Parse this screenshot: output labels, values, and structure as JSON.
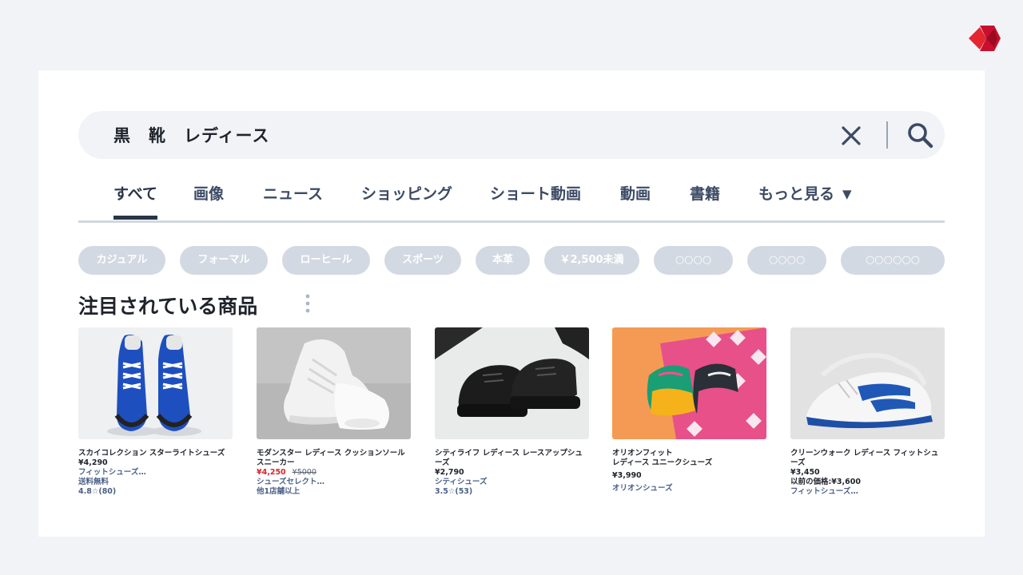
{
  "search": {
    "query": "黒　靴　レディース"
  },
  "tabs": [
    {
      "label": "すべて"
    },
    {
      "label": "画像"
    },
    {
      "label": "ニュース"
    },
    {
      "label": "ショッピング"
    },
    {
      "label": "ショート動画"
    },
    {
      "label": "動画"
    },
    {
      "label": "書籍"
    },
    {
      "label": "もっと見る",
      "caret": "▼"
    }
  ],
  "active_tab": "すべて",
  "chips": [
    {
      "label": "カジュアル"
    },
    {
      "label": "フォーマル"
    },
    {
      "label": "ローヒール"
    },
    {
      "label": "スポーツ"
    },
    {
      "label": "本革"
    },
    {
      "label": "￥2,500未満"
    },
    {
      "label": "○○○○"
    },
    {
      "label": "○○○○"
    },
    {
      "label": "○○○○○○"
    }
  ],
  "section": {
    "title": "注目されている商品"
  },
  "products": [
    {
      "name": "スカイコレクション スターライトシューズ",
      "price": "¥4,290",
      "shop": "フィットシューズ…",
      "line3": "送料無料",
      "line4": "4.8☆(80)",
      "image": "blue-suede-sneakers"
    },
    {
      "name": "モダンスター レディース クッションソール スニーカー",
      "price": "¥4,250",
      "old_price": "¥5000",
      "shop": "シューズセレクト…",
      "line3": "他1店舗以上",
      "image": "white-chunky-sneakers"
    },
    {
      "name": "シティライフ レディース レースアップシューズ",
      "price": "¥2,790",
      "shop": "シティシューズ",
      "line3": "3.5☆(53)",
      "image": "black-platform-lace-up-shoes"
    },
    {
      "name": "オリオンフィット\nレディース ユニークシューズ",
      "price": "¥3,990",
      "shop": "オリオンシューズ",
      "image": "colorful-sneakers"
    },
    {
      "name": "クリーンウォーク レディース フィットシューズ",
      "price": "¥3,450",
      "line3": "以前の価格:¥3,600",
      "shop": "フィットシューズ…",
      "image": "white-blue-sneakers"
    }
  ],
  "colors": {
    "brand": "#c8102e",
    "accent": "#2a3447",
    "chip_bg": "#d3d9e2",
    "sale": "#d2272b",
    "link": "#4a5f86"
  }
}
